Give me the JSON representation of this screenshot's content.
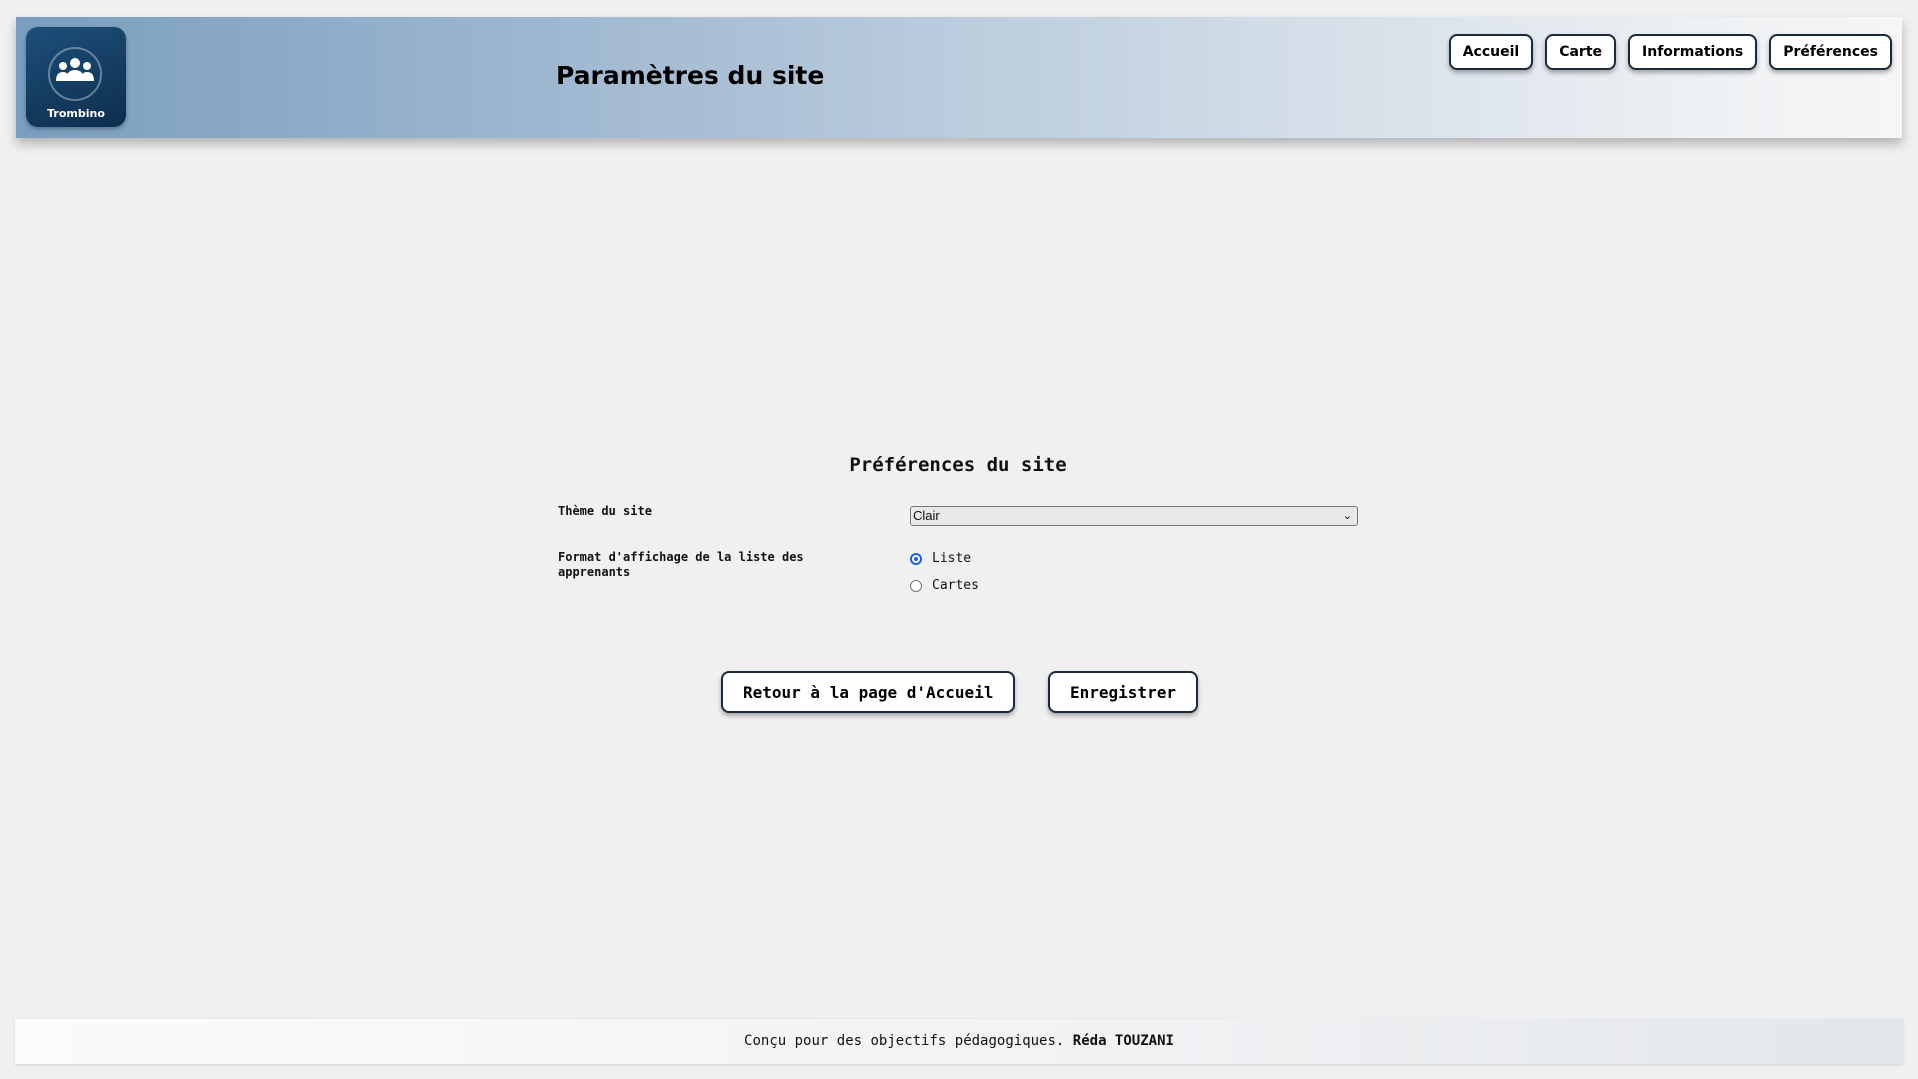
{
  "header": {
    "logo_label": "Trombino",
    "title": "Paramètres du site",
    "nav": [
      "Accueil",
      "Carte",
      "Informations",
      "Préférences"
    ]
  },
  "main": {
    "section_title": "Préférences du site",
    "theme_label": "Thème du site",
    "theme_value": "Clair",
    "format_label": "Format d'affichage de la liste des apprenants",
    "format_options": [
      "Liste",
      "Cartes"
    ],
    "format_selected": "Liste",
    "back_button": "Retour à la page d'Accueil",
    "save_button": "Enregistrer"
  },
  "footer": {
    "text": "Conçu pour des objectifs pédagogiques.",
    "author": "Réda TOUZANI"
  },
  "colors": {
    "logo_bg": "#0d2e4d",
    "radio_accent": "#1a64d6"
  }
}
